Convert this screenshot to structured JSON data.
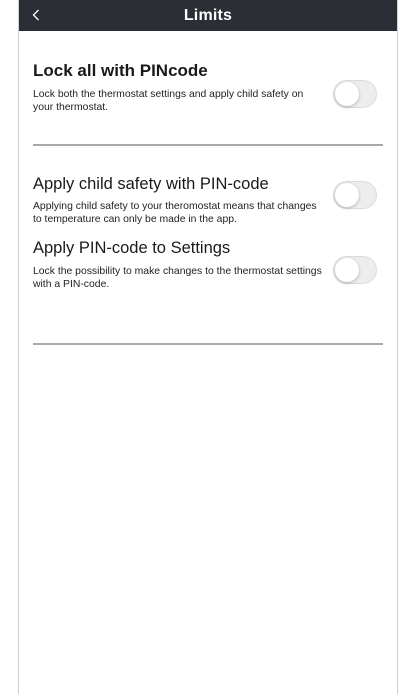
{
  "header": {
    "title": "Limits",
    "back_icon": "chevron-left-icon",
    "background": "#2c2e35"
  },
  "settings": [
    {
      "title": "Lock all with PINcode",
      "description": "Lock both the thermostat settings and apply child safety on your thermostat.",
      "enabled": false
    },
    {
      "title": "Apply child safety with PIN-code",
      "description": "Applying child safety to your theromostat means that changes to temperature can only be made in the app.",
      "enabled": false
    },
    {
      "title": "Apply PIN-code to Settings",
      "description": "Lock the possibility to make changes to the thermostat settings with a PIN-code.",
      "enabled": false
    }
  ]
}
